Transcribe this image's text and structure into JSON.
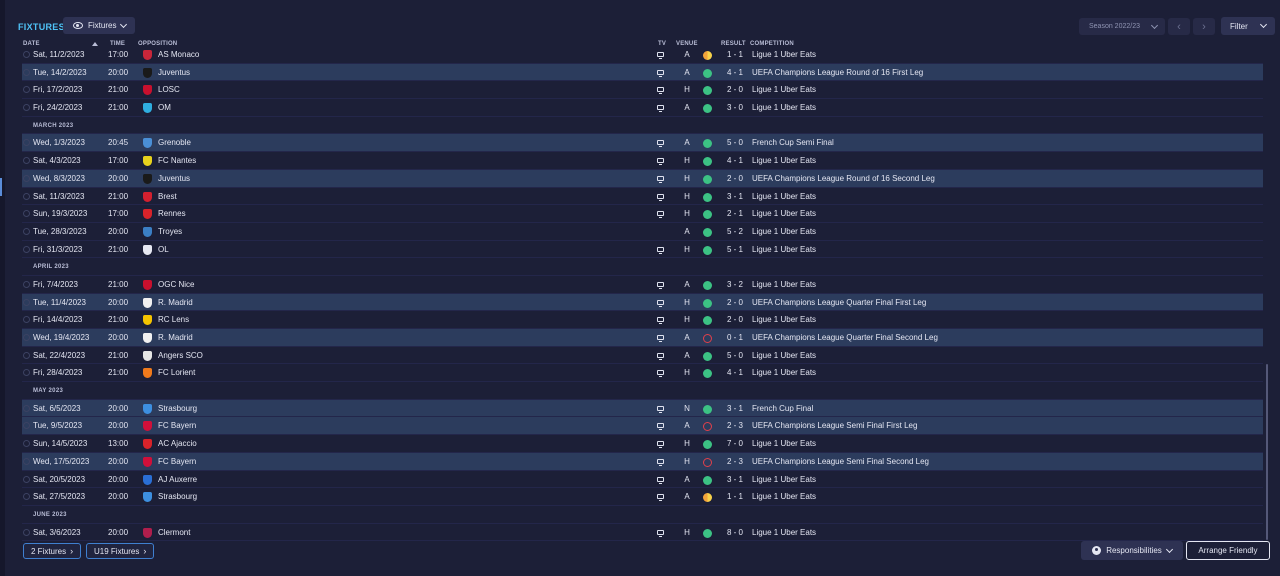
{
  "header": {
    "title": "FIXTURES",
    "view_label": "Fixtures",
    "season_label": "Season 2022/23",
    "filter_label": "Filter"
  },
  "columns": {
    "date": "DATE",
    "time": "TIME",
    "opposition": "OPPOSITION",
    "tv": "TV",
    "venue": "VENUE",
    "result": "RESULT",
    "competition": "COMPETITION"
  },
  "rows": [
    {
      "date": "Sat, 11/2/2023",
      "time": "17:00",
      "opposition": "AS Monaco",
      "tv": true,
      "venue": "A",
      "result": "draw",
      "score": "1 - 1",
      "competition": "Ligue 1 Uber Eats",
      "crest": "#c8263a",
      "highlight": false
    },
    {
      "date": "Tue, 14/2/2023",
      "time": "20:00",
      "opposition": "Juventus",
      "tv": true,
      "venue": "A",
      "result": "win",
      "score": "4 - 1",
      "competition": "UEFA Champions League Round of 16  First Leg",
      "crest": "#1a1a1a",
      "highlight": true
    },
    {
      "date": "Fri, 17/2/2023",
      "time": "21:00",
      "opposition": "LOSC",
      "tv": true,
      "venue": "H",
      "result": "win",
      "score": "2 - 0",
      "competition": "Ligue 1 Uber Eats",
      "crest": "#c8102e",
      "highlight": false
    },
    {
      "date": "Fri, 24/2/2023",
      "time": "21:00",
      "opposition": "OM",
      "tv": true,
      "venue": "A",
      "result": "win",
      "score": "3 - 0",
      "competition": "Ligue 1 Uber Eats",
      "crest": "#2faee0",
      "highlight": false
    },
    {
      "month": "MARCH 2023"
    },
    {
      "date": "Wed, 1/3/2023",
      "time": "20:45",
      "opposition": "Grenoble",
      "tv": true,
      "venue": "A",
      "result": "win",
      "score": "5 - 0",
      "competition": "French Cup Semi Final",
      "crest": "#4a8fd6",
      "highlight": true
    },
    {
      "date": "Sat, 4/3/2023",
      "time": "17:00",
      "opposition": "FC Nantes",
      "tv": true,
      "venue": "H",
      "result": "win",
      "score": "4 - 1",
      "competition": "Ligue 1 Uber Eats",
      "crest": "#e8d21d",
      "highlight": false
    },
    {
      "date": "Wed, 8/3/2023",
      "time": "20:00",
      "opposition": "Juventus",
      "tv": true,
      "venue": "H",
      "result": "win",
      "score": "2 - 0",
      "competition": "UEFA Champions League Round of 16  Second Leg",
      "crest": "#1a1a1a",
      "highlight": true
    },
    {
      "date": "Sat, 11/3/2023",
      "time": "21:00",
      "opposition": "Brest",
      "tv": true,
      "venue": "H",
      "result": "win",
      "score": "3 - 1",
      "competition": "Ligue 1 Uber Eats",
      "crest": "#d3202f",
      "highlight": false
    },
    {
      "date": "Sun, 19/3/2023",
      "time": "17:00",
      "opposition": "Rennes",
      "tv": true,
      "venue": "H",
      "result": "win",
      "score": "2 - 1",
      "competition": "Ligue 1 Uber Eats",
      "crest": "#d8232a",
      "highlight": false
    },
    {
      "date": "Tue, 28/3/2023",
      "time": "20:00",
      "opposition": "Troyes",
      "tv": false,
      "venue": "A",
      "result": "win",
      "score": "5 - 2",
      "competition": "Ligue 1 Uber Eats",
      "crest": "#3b7fc4",
      "highlight": false
    },
    {
      "date": "Fri, 31/3/2023",
      "time": "21:00",
      "opposition": "OL",
      "tv": true,
      "venue": "H",
      "result": "win",
      "score": "5 - 1",
      "competition": "Ligue 1 Uber Eats",
      "crest": "#e6e8f2",
      "highlight": false
    },
    {
      "month": "APRIL 2023"
    },
    {
      "date": "Fri, 7/4/2023",
      "time": "21:00",
      "opposition": "OGC Nice",
      "tv": true,
      "venue": "A",
      "result": "win",
      "score": "3 - 2",
      "competition": "Ligue 1 Uber Eats",
      "crest": "#c8102e",
      "highlight": false
    },
    {
      "date": "Tue, 11/4/2023",
      "time": "20:00",
      "opposition": "R. Madrid",
      "tv": true,
      "venue": "H",
      "result": "win",
      "score": "2 - 0",
      "competition": "UEFA Champions League Quarter Final First Leg",
      "crest": "#f1f1f1",
      "highlight": true
    },
    {
      "date": "Fri, 14/4/2023",
      "time": "21:00",
      "opposition": "RC Lens",
      "tv": true,
      "venue": "H",
      "result": "win",
      "score": "2 - 0",
      "competition": "Ligue 1 Uber Eats",
      "crest": "#f5c400",
      "highlight": false
    },
    {
      "date": "Wed, 19/4/2023",
      "time": "20:00",
      "opposition": "R. Madrid",
      "tv": true,
      "venue": "A",
      "result": "loss",
      "score": "0 - 1",
      "competition": "UEFA Champions League Quarter Final Second Leg",
      "crest": "#f1f1f1",
      "highlight": true
    },
    {
      "date": "Sat, 22/4/2023",
      "time": "21:00",
      "opposition": "Angers SCO",
      "tv": true,
      "venue": "A",
      "result": "win",
      "score": "5 - 0",
      "competition": "Ligue 1 Uber Eats",
      "crest": "#e6e6e6",
      "highlight": false
    },
    {
      "date": "Fri, 28/4/2023",
      "time": "21:00",
      "opposition": "FC Lorient",
      "tv": true,
      "venue": "H",
      "result": "win",
      "score": "4 - 1",
      "competition": "Ligue 1 Uber Eats",
      "crest": "#f07a1c",
      "highlight": false
    },
    {
      "month": "MAY 2023"
    },
    {
      "date": "Sat, 6/5/2023",
      "time": "20:00",
      "opposition": "Strasbourg",
      "tv": true,
      "venue": "N",
      "result": "win",
      "score": "3 - 1",
      "competition": "French Cup Final",
      "crest": "#3d8fe0",
      "highlight": true
    },
    {
      "date": "Tue, 9/5/2023",
      "time": "20:00",
      "opposition": "FC Bayern",
      "tv": true,
      "venue": "A",
      "result": "loss",
      "score": "2 - 3",
      "competition": "UEFA Champions League Semi Final First Leg",
      "crest": "#d0103a",
      "highlight": true
    },
    {
      "date": "Sun, 14/5/2023",
      "time": "13:00",
      "opposition": "AC Ajaccio",
      "tv": true,
      "venue": "H",
      "result": "win",
      "score": "7 - 0",
      "competition": "Ligue 1 Uber Eats",
      "crest": "#d8232a",
      "highlight": false
    },
    {
      "date": "Wed, 17/5/2023",
      "time": "20:00",
      "opposition": "FC Bayern",
      "tv": true,
      "venue": "H",
      "result": "loss",
      "score": "2 - 3",
      "competition": "UEFA Champions League Semi Final Second Leg",
      "crest": "#d0103a",
      "highlight": true
    },
    {
      "date": "Sat, 20/5/2023",
      "time": "20:00",
      "opposition": "AJ Auxerre",
      "tv": true,
      "venue": "A",
      "result": "win",
      "score": "3 - 1",
      "competition": "Ligue 1 Uber Eats",
      "crest": "#2a6fd6",
      "highlight": false
    },
    {
      "date": "Sat, 27/5/2023",
      "time": "20:00",
      "opposition": "Strasbourg",
      "tv": true,
      "venue": "A",
      "result": "draw",
      "score": "1 - 1",
      "competition": "Ligue 1 Uber Eats",
      "crest": "#3d8fe0",
      "highlight": false
    },
    {
      "month": "JUNE 2023"
    },
    {
      "date": "Sat, 3/6/2023",
      "time": "20:00",
      "opposition": "Clermont",
      "tv": true,
      "venue": "H",
      "result": "win",
      "score": "8 - 0",
      "competition": "Ligue 1 Uber Eats",
      "crest": "#b01e4c",
      "highlight": false
    }
  ],
  "footer": {
    "fixtures_label": "2 Fixtures",
    "u19_label": "U19 Fixtures",
    "responsibilities_label": "Responsibilities",
    "arrange_label": "Arrange Friendly"
  },
  "colors": {
    "accent": "#4fc3f7",
    "win": "#3cc284",
    "loss": "#e0404b",
    "draw": "#f2a33a",
    "highlight_row": "#2c3c5d",
    "background": "#1c1f37"
  }
}
